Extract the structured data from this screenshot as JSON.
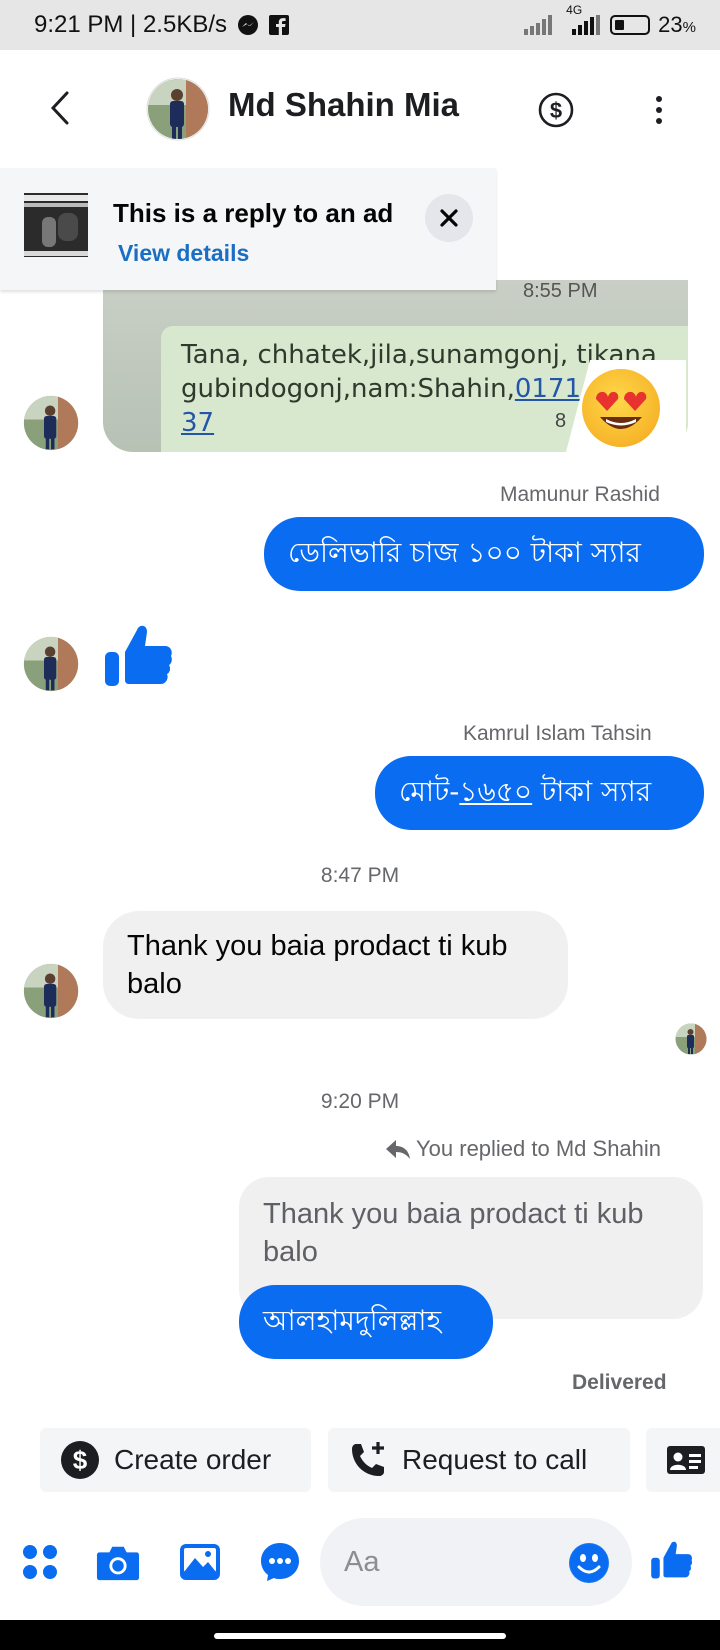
{
  "status_bar": {
    "time_speed": "9:21 PM | 2.5KB/s",
    "network": "4G",
    "battery": "23",
    "battery_suffix": "%"
  },
  "header": {
    "contact_name": "Md Shahin Mia"
  },
  "ad_banner": {
    "title": "This is a reply to an ad",
    "link": "View details"
  },
  "photo_message": {
    "top_text": "8:55 PM",
    "line1": "Tana, chhatek,jila,sunamgonj, tikana",
    "line2_prefix": "gubindogonj,nam:Shahin,",
    "line2_number": "0171",
    "line3": "37",
    "corner": "8"
  },
  "messages": [
    {
      "sender": "Mamunur Rashid",
      "text": "ডেলিভারি চাজ ১০০ টাকা স্যার"
    },
    {
      "sender": "Kamrul Islam Tahsin",
      "text_prefix": "মোট-",
      "text_link": "১৬৫০",
      "text_suffix": " টাকা স্যার"
    }
  ],
  "timestamps": [
    "8:47 PM",
    "9:20 PM"
  ],
  "incoming_text": "Thank you baia prodact ti kub balo",
  "reply": {
    "note": "You replied to Md Shahin",
    "quoted": "Thank you baia prodact ti kub balo",
    "text": "আলহামদুলিল্লাহ"
  },
  "status": "Delivered",
  "quick_actions": [
    {
      "label": "Create order",
      "icon": "dollar-circle-icon"
    },
    {
      "label": "Request to call",
      "icon": "phone-add-icon"
    },
    {
      "label": "",
      "icon": "contact-card-icon"
    }
  ],
  "composer": {
    "placeholder": "Aa"
  },
  "colors": {
    "messenger_blue": "#0a6cf0",
    "link_blue": "#1a6fc4",
    "gray_bubble": "#f0f0f1"
  }
}
